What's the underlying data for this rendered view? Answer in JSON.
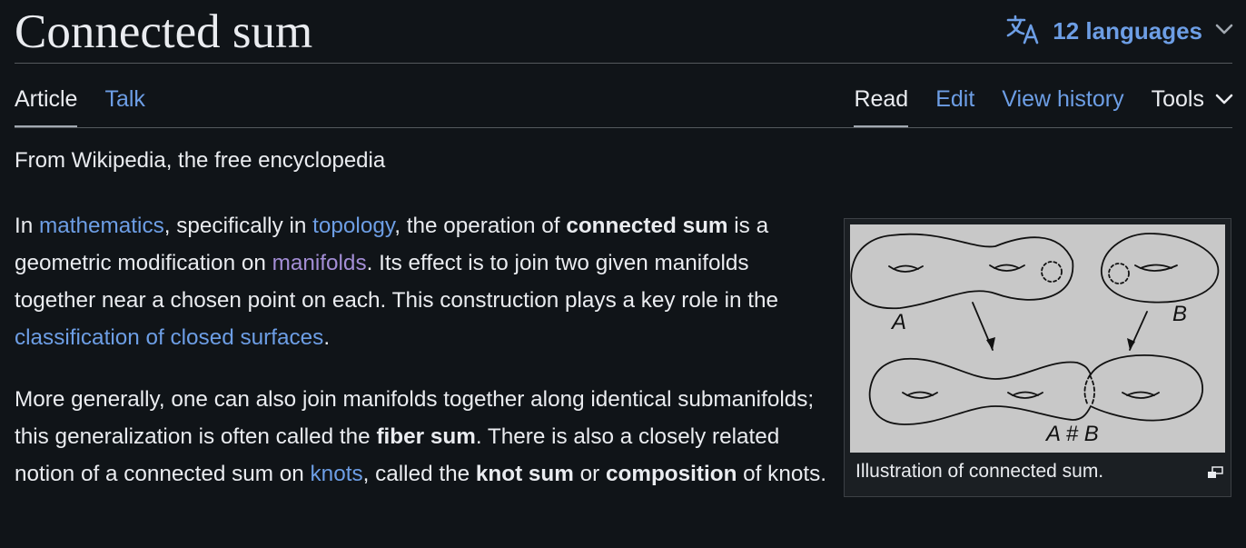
{
  "header": {
    "title": "Connected sum",
    "languages_label": "12 languages"
  },
  "tabs": {
    "article": "Article",
    "talk": "Talk",
    "read": "Read",
    "edit": "Edit",
    "view_history": "View history",
    "tools": "Tools"
  },
  "tagline": "From Wikipedia, the free encyclopedia",
  "paragraph1": {
    "t1": "In ",
    "link_mathematics": "mathematics",
    "t2": ", specifically in ",
    "link_topology": "topology",
    "t3": ", the operation of ",
    "bold_connected_sum": "connected sum",
    "t4": " is a geometric modification on ",
    "link_manifolds": "manifolds",
    "t5": ". Its effect is to join two given manifolds together near a chosen point on each. This construction plays a key role in the ",
    "link_classification": "classification of closed surfaces",
    "t6": "."
  },
  "paragraph2": {
    "t1": "More generally, one can also join manifolds together along identical submanifolds; this generalization is often called the ",
    "bold_fiber_sum": "fiber sum",
    "t2": ". There is also a closely related notion of a connected sum on ",
    "link_knots": "knots",
    "t3": ", called the ",
    "bold_knot_sum": "knot sum",
    "t4": " or ",
    "bold_composition": "composition",
    "t5": " of knots."
  },
  "figure": {
    "label_a": "A",
    "label_b": "B",
    "label_sum": "A # B",
    "caption": "Illustration of connected sum."
  },
  "colors": {
    "background": "#101418",
    "text": "#eaecf0",
    "link": "#6d9ee5",
    "visited_link": "#a48ed6",
    "divider": "#54595d",
    "figure_bg": "#c8c8c8"
  },
  "icons": {
    "language": "translate-icon",
    "chevron": "chevron-down-icon",
    "enlarge": "enlarge-icon"
  }
}
